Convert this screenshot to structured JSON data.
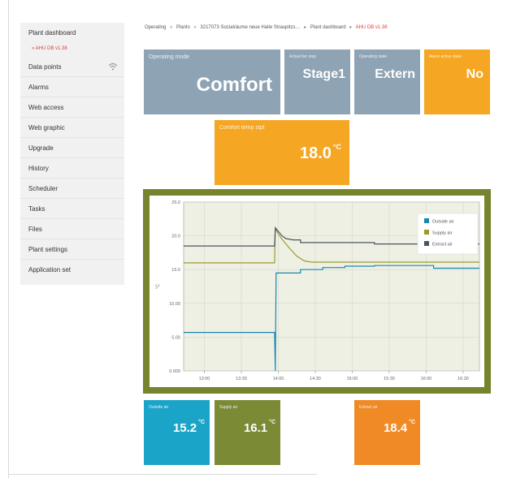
{
  "sidebar": {
    "items": [
      {
        "label": "Plant dashboard"
      },
      {
        "label": "Data points"
      },
      {
        "label": "Alarms"
      },
      {
        "label": "Web access"
      },
      {
        "label": "Web graphic"
      },
      {
        "label": "Upgrade"
      },
      {
        "label": "History"
      },
      {
        "label": "Scheduler"
      },
      {
        "label": "Tasks"
      },
      {
        "label": "Files"
      },
      {
        "label": "Plant settings"
      },
      {
        "label": "Application set"
      }
    ],
    "sub_item": "» AHU DB v1.38"
  },
  "breadcrumb": {
    "items": [
      "Operating",
      "Plants",
      "3217073 Sozialräume neue Halle Straupitzs…",
      "Plant dashboard",
      "AHU DB v1.38"
    ],
    "separators": [
      "»",
      "»",
      "▸",
      "▸"
    ]
  },
  "tiles": {
    "operating_mode": {
      "label": "Operating mode",
      "value": "Comfort"
    },
    "actual_fan_step": {
      "label": "Actual fan step",
      "value": "Stage1"
    },
    "operating_state": {
      "label": "Operating state",
      "value": "Extern"
    },
    "alarm": {
      "label": "Alarm active state",
      "value": "No"
    },
    "comfort_temp": {
      "label": "Comfort temp stpt",
      "value": "18.0",
      "unit": "°C"
    },
    "outside_air": {
      "label": "Outside air",
      "value": "15.2",
      "unit": "°C"
    },
    "supply_air": {
      "label": "Supply air",
      "value": "16.1",
      "unit": "°C"
    },
    "extract_air": {
      "label": "Extract air",
      "value": "18.4",
      "unit": "°C"
    }
  },
  "colors": {
    "slate": "#8ea3b3",
    "orange": "#f5a623",
    "teal": "#1aa5c8",
    "olive": "#7b8a34",
    "dark_orange": "#f08a24",
    "chart_frame": "#77842e"
  },
  "chart_data": {
    "type": "line",
    "y_ticks": [
      "0.000",
      "5.00",
      "10.00",
      "15.0",
      "20.0",
      "25.0"
    ],
    "x_ticks": [
      "13:00",
      "13:30",
      "14:00",
      "14:30",
      "15:00",
      "15:30",
      "16:00",
      "16:30"
    ],
    "ylabel": "°C",
    "ylim": [
      0,
      25
    ],
    "legend_position": "top-right",
    "series": [
      {
        "name": "Outside air",
        "color": "#1a86b0",
        "points": [
          [
            12.72,
            5.7
          ],
          [
            13.95,
            5.7
          ],
          [
            13.96,
            0
          ],
          [
            13.97,
            14.5
          ],
          [
            14.3,
            14.5
          ],
          [
            14.3,
            15.0
          ],
          [
            14.6,
            15.0
          ],
          [
            14.6,
            15.3
          ],
          [
            14.9,
            15.3
          ],
          [
            14.9,
            15.5
          ],
          [
            15.3,
            15.5
          ],
          [
            15.3,
            15.6
          ],
          [
            16.1,
            15.6
          ],
          [
            16.1,
            15.2
          ],
          [
            16.72,
            15.2
          ]
        ]
      },
      {
        "name": "Supply air",
        "color": "#9a9a2e",
        "points": [
          [
            12.72,
            16.0
          ],
          [
            13.95,
            16.0
          ],
          [
            13.96,
            21.0
          ],
          [
            14.05,
            19.5
          ],
          [
            14.15,
            18.2
          ],
          [
            14.25,
            17.0
          ],
          [
            14.35,
            16.3
          ],
          [
            14.45,
            16.1
          ],
          [
            16.72,
            16.1
          ]
        ]
      },
      {
        "name": "Extract air",
        "color": "#4a5560",
        "points": [
          [
            12.72,
            18.5
          ],
          [
            13.95,
            18.5
          ],
          [
            13.96,
            21.2
          ],
          [
            14.05,
            20.0
          ],
          [
            14.1,
            19.6
          ],
          [
            14.2,
            19.4
          ],
          [
            14.3,
            19.4
          ],
          [
            14.3,
            19.0
          ],
          [
            15.3,
            19.0
          ],
          [
            15.3,
            18.8
          ],
          [
            16.72,
            18.8
          ]
        ]
      }
    ]
  }
}
